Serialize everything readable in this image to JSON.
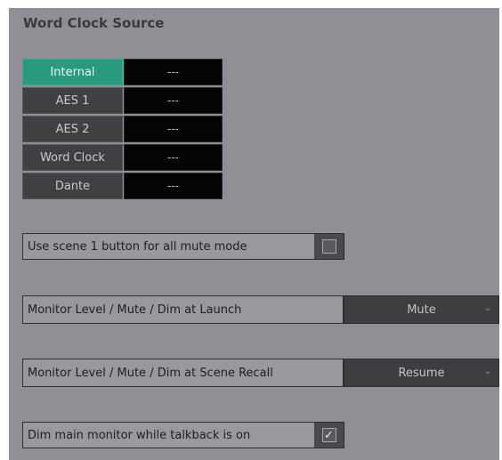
{
  "panel": {
    "title": "Word Clock Source"
  },
  "sources": [
    {
      "label": "Internal",
      "value": "---",
      "active": true
    },
    {
      "label": "AES 1",
      "value": "---",
      "active": false
    },
    {
      "label": "AES 2",
      "value": "---",
      "active": false
    },
    {
      "label": "Word Clock",
      "value": "---",
      "active": false
    },
    {
      "label": "Dante",
      "value": "---",
      "active": false
    }
  ],
  "options": {
    "scene1": {
      "label": "Use scene 1 button for all mute mode",
      "checked": false
    },
    "launch": {
      "label": "Monitor Level / Mute / Dim at Launch",
      "value": "Mute"
    },
    "recall": {
      "label": "Monitor Level / Mute / Dim at Scene Recall",
      "value": "Resume"
    },
    "talkback": {
      "label": "Dim main monitor while talkback is on",
      "checked": true,
      "mark": "✓"
    }
  },
  "colors": {
    "accent": "#2a9a7c",
    "panel": "#8f8f95",
    "display": "#050505"
  },
  "icons": {
    "checkbox": "check-icon",
    "dropdown": "chevron-down-icon"
  }
}
